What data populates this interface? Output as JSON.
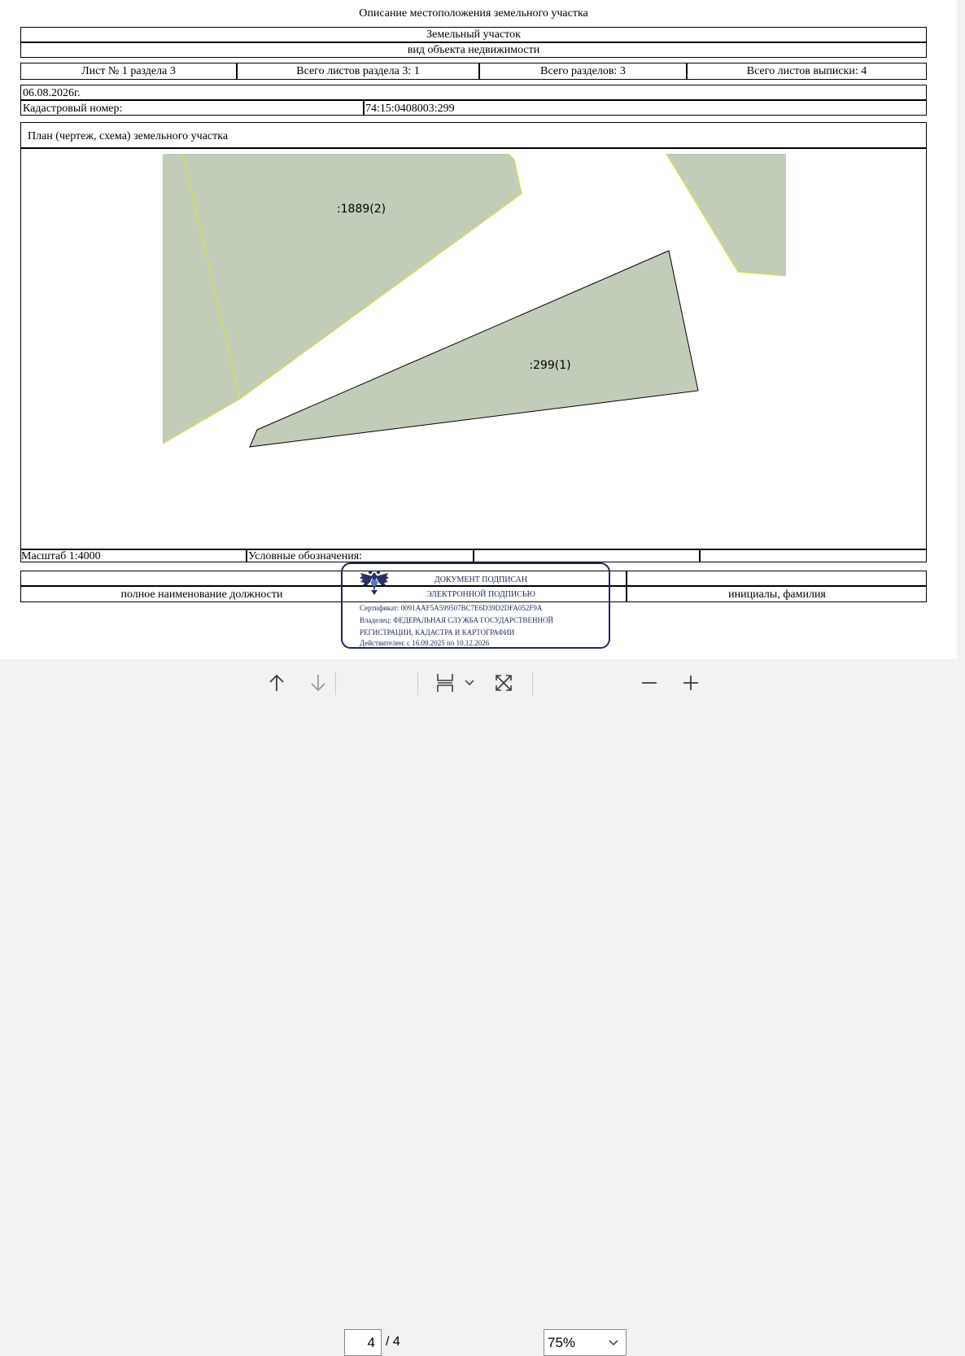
{
  "document": {
    "title": "Описание местоположения земельного участка",
    "object_type": "Земельный участок",
    "object_type_caption": "вид объекта недвижимости",
    "sheet": "Лист № 1 раздела 3",
    "sheets_in_section": "Всего листов раздела 3: 1",
    "sections_total": "Всего разделов: 3",
    "sheets_total": "Всего листов выписки: 4",
    "date": "06.08.2026г.",
    "cadastral_label": "Кадастровый номер:",
    "cadastral_number": "74:15:0408003:299",
    "plan_title": "План (чертеж, схема) земельного участка",
    "scale": "Масштаб 1:4000",
    "legend_label": "Условные обозначения:",
    "position_caption": "полное наименование должности",
    "name_caption": "инициалы, фамилия"
  },
  "plan": {
    "parcel_main_label": ":299(1)",
    "parcel_neighbor_label": ":1889(2)",
    "fill_color": "#c2cdb9",
    "neighbor_border_color": "#d8e040",
    "main_border_color": "#000000"
  },
  "stamp": {
    "line1": "ДОКУМЕНТ ПОДПИСАН",
    "line2": "ЭЛЕКТРОННОЙ ПОДПИСЬЮ",
    "certificate": "Сертификат: 0091AAF5A599507BC7E6D39D2DFA052F9A",
    "owner_line1": "Владелец: ФЕДЕРАЛЬНАЯ СЛУЖБА ГОСУДАРСТВЕННОЙ",
    "owner_line2": "РЕГИСТРАЦИИ, КАДАСТРА И КАРТОГРАФИИ",
    "valid": "Действителен: с 16.09.2025 по 10.12.2026",
    "color": "#1f2a5a"
  },
  "toolbar": {
    "current_page": "4",
    "total_pages": "/ 4",
    "zoom": "75%",
    "icons": [
      "arrow-up-icon",
      "arrow-down-icon",
      "fit-page-icon",
      "chevron-down-icon",
      "fullscreen-icon",
      "zoom-out-icon",
      "zoom-in-icon"
    ]
  }
}
